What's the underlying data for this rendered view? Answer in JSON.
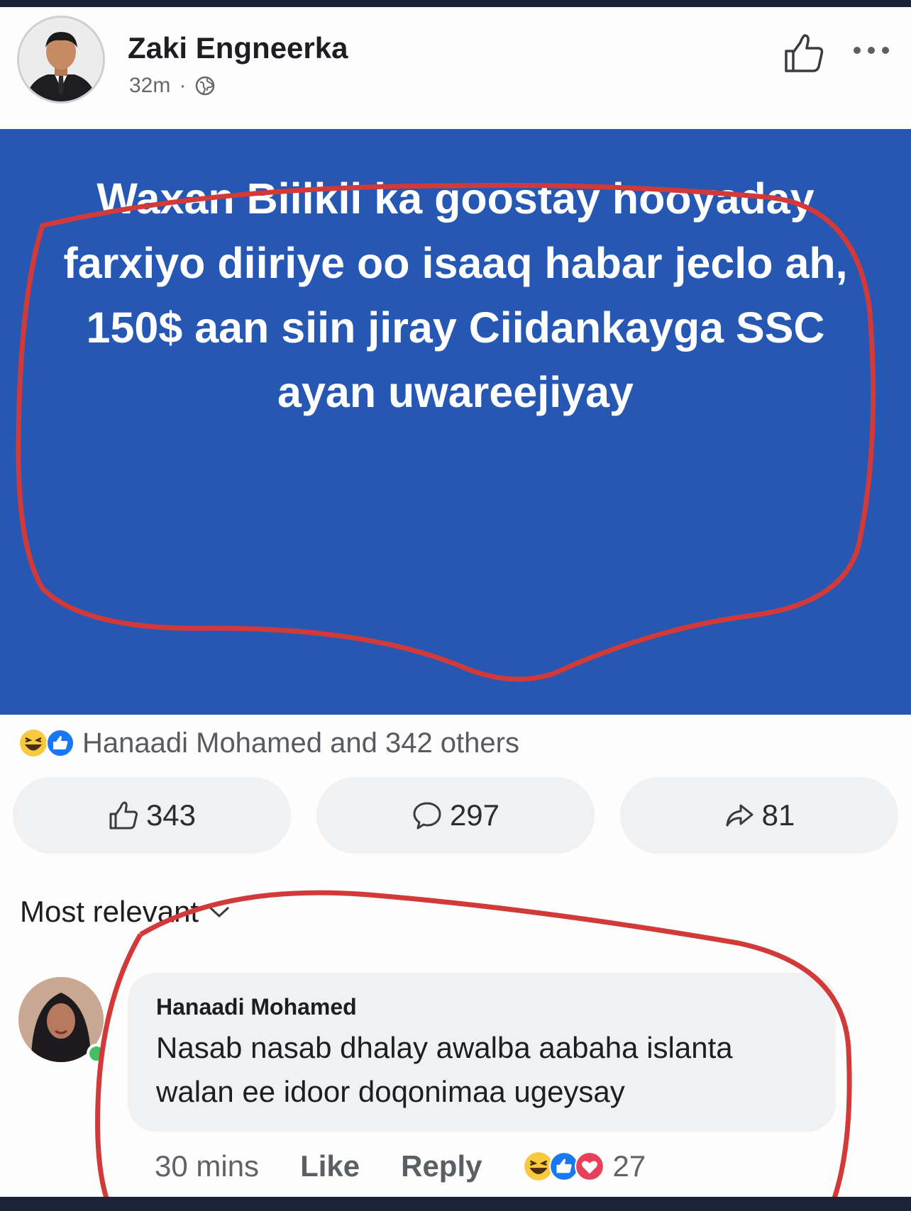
{
  "post": {
    "author": "Zaki Engneerka",
    "time": "32m",
    "separator": "·",
    "text_lines": [
      "Waxan Biilkii ka goostay hooyaday",
      "farxiyo diiriye oo isaaq habar jeclo ah,",
      "150$ aan siin jiray Ciidankayga SSC",
      "ayan uwareejiyay"
    ]
  },
  "reactions": {
    "summary": "Hanaadi Mohamed and 342 others",
    "icons": [
      "haha-icon",
      "like-reaction-icon"
    ]
  },
  "stats": {
    "likes": "343",
    "comments": "297",
    "shares": "81"
  },
  "comments_section": {
    "sort_label": "Most relevant"
  },
  "comment": {
    "author": "Hanaadi Mohamed",
    "text_lines": [
      "Nasab nasab dhalay awalba aabaha islanta",
      "walan ee idoor doqonimaa ugeysay"
    ],
    "time": "30 mins",
    "like_label": "Like",
    "reply_label": "Reply",
    "reaction_count": "27"
  },
  "colors": {
    "post_background": "#2657b3",
    "annotation_red": "#d23a3a",
    "button_background": "#f0f1f3"
  }
}
